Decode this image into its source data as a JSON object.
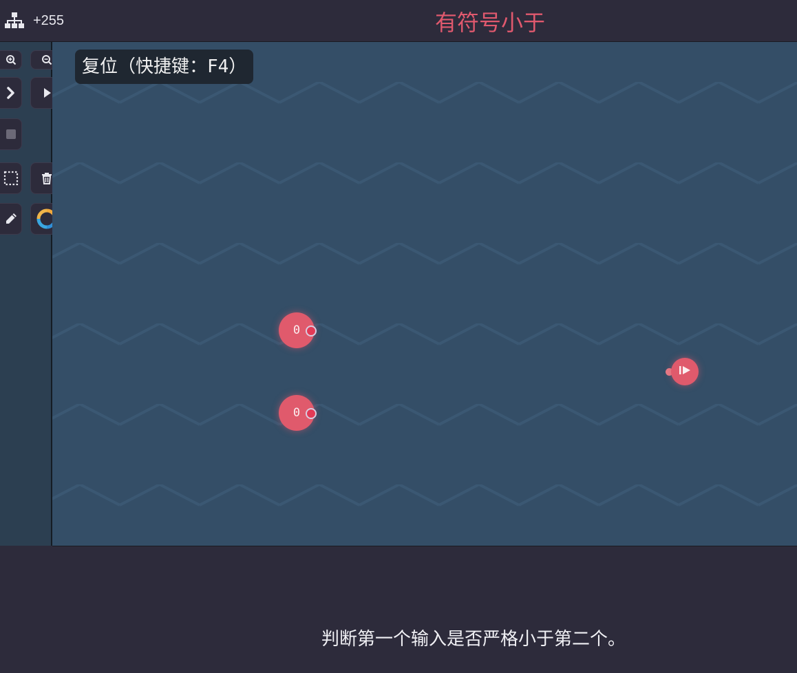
{
  "header": {
    "node_count": "+255",
    "level_title": "有符号小于"
  },
  "tooltip": {
    "text": "复位（快捷键：F4）"
  },
  "toolbar": {
    "buttons": [
      {
        "name": "zoom-in-button",
        "icon": "zoom-in-icon"
      },
      {
        "name": "zoom-out-button",
        "icon": "zoom-out-icon"
      },
      {
        "name": "step-button",
        "icon": "chevron-right-icon"
      },
      {
        "name": "run-button",
        "icon": "play-icon"
      },
      {
        "name": "stop-button",
        "icon": "stop-icon"
      },
      {
        "name": "select-button",
        "icon": "dotted-select-icon"
      },
      {
        "name": "delete-button",
        "icon": "trash-icon"
      },
      {
        "name": "edit-button",
        "icon": "pencil-icon"
      },
      {
        "name": "color-button",
        "icon": "color-ring-icon"
      }
    ]
  },
  "canvas": {
    "nodes": [
      {
        "name": "input-node-1",
        "value": "0"
      },
      {
        "name": "input-node-2",
        "value": "0"
      },
      {
        "name": "output-node",
        "icon": "play-bar-icon"
      }
    ]
  },
  "description": "判断第一个输入是否严格小于第二个。",
  "colors": {
    "accent": "#e05a6c",
    "background": "#2d2b3b",
    "canvas": "#344e67"
  }
}
